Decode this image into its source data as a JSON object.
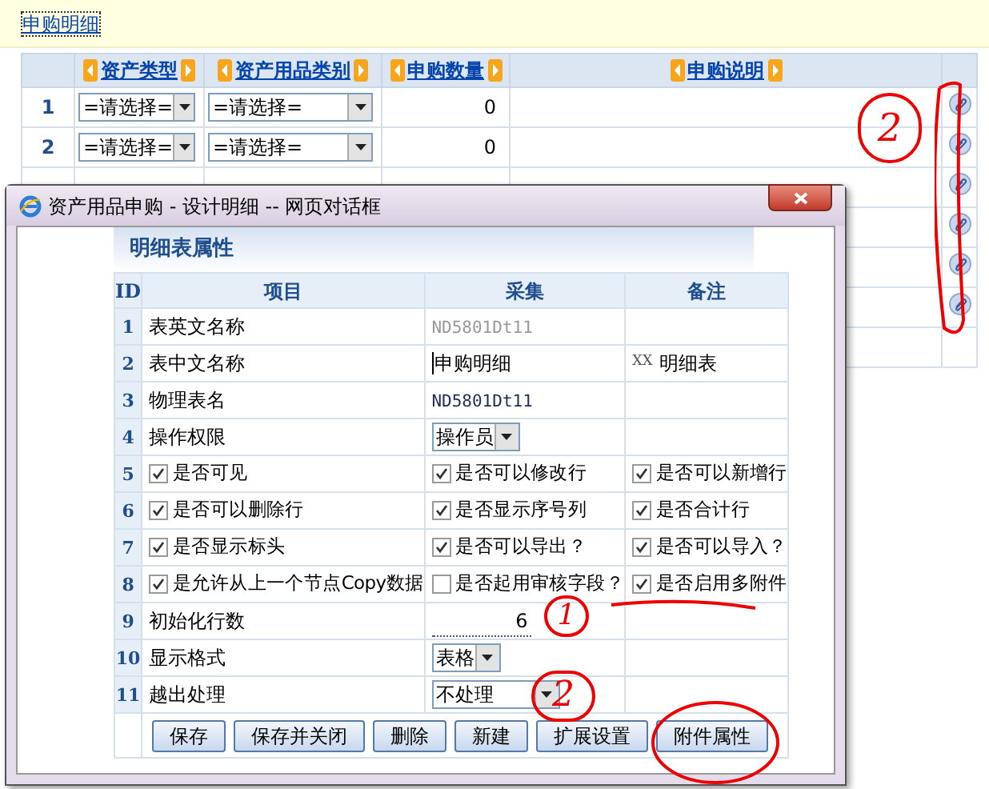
{
  "page": {
    "link": "申购明细",
    "columns": [
      {
        "label": "资产类型"
      },
      {
        "label": "资产用品类别"
      },
      {
        "label": "申购数量"
      },
      {
        "label": "申购说明"
      }
    ],
    "rows": [
      {
        "kind": "full",
        "index": "1",
        "type": "=请选择=",
        "category": "=请选择=",
        "quantity": "0"
      },
      {
        "kind": "full",
        "index": "2",
        "type": "=请选择=",
        "category": "=请选择=",
        "quantity": "0"
      },
      {
        "kind": "covered"
      },
      {
        "kind": "covered"
      },
      {
        "kind": "covered"
      },
      {
        "kind": "covered"
      },
      {
        "kind": "blank"
      }
    ]
  },
  "dialog": {
    "title": "资产用品申购 - 设计明细 -- 网页对话框",
    "section_title": "明细表属性",
    "columns": [
      "ID",
      "项目",
      "采集",
      "备注"
    ],
    "rows": [
      {
        "id": "1",
        "kind": "text",
        "item": "表英文名称",
        "value": "ND5801Dt11",
        "value_disabled": true,
        "note": ""
      },
      {
        "id": "2",
        "kind": "input",
        "item": "表中文名称",
        "value": "申购明细",
        "note": "明细表"
      },
      {
        "id": "3",
        "kind": "text",
        "item": "物理表名",
        "value": "ND5801Dt11",
        "value_disabled": false,
        "note": ""
      },
      {
        "id": "4",
        "kind": "select",
        "item": "操作权限",
        "value": "操作员",
        "note": ""
      },
      {
        "id": "5",
        "kind": "checks",
        "checks": [
          {
            "label": "是否可见",
            "checked": true
          },
          {
            "label": "是否可以修改行",
            "checked": true
          },
          {
            "label": "是否可以新增行",
            "checked": true
          }
        ]
      },
      {
        "id": "6",
        "kind": "checks",
        "checks": [
          {
            "label": "是否可以删除行",
            "checked": true
          },
          {
            "label": "是否显示序号列",
            "checked": true
          },
          {
            "label": "是否合计行",
            "checked": true
          }
        ]
      },
      {
        "id": "7",
        "kind": "checks",
        "checks": [
          {
            "label": "是否显示标头",
            "checked": true
          },
          {
            "label": "是否可以导出？",
            "checked": true
          },
          {
            "label": "是否可以导入？",
            "checked": true
          }
        ]
      },
      {
        "id": "8",
        "kind": "checks",
        "checks": [
          {
            "label": "是允许从上一个节点Copy数据",
            "checked": true
          },
          {
            "label": "是否起用审核字段？",
            "checked": false
          },
          {
            "label": "是否启用多附件",
            "checked": true
          }
        ]
      },
      {
        "id": "9",
        "kind": "number",
        "item": "初始化行数",
        "value": "6"
      },
      {
        "id": "10",
        "kind": "select",
        "item": "显示格式",
        "value": "表格"
      },
      {
        "id": "11",
        "kind": "select_wide",
        "item": "越出处理",
        "value": "不处理"
      }
    ],
    "note_prefix": "XX",
    "buttons": [
      "保存",
      "保存并关闭",
      "删除",
      "新建",
      "扩展设置",
      "附件属性"
    ]
  },
  "annotations": [
    "2",
    "1",
    "2"
  ]
}
